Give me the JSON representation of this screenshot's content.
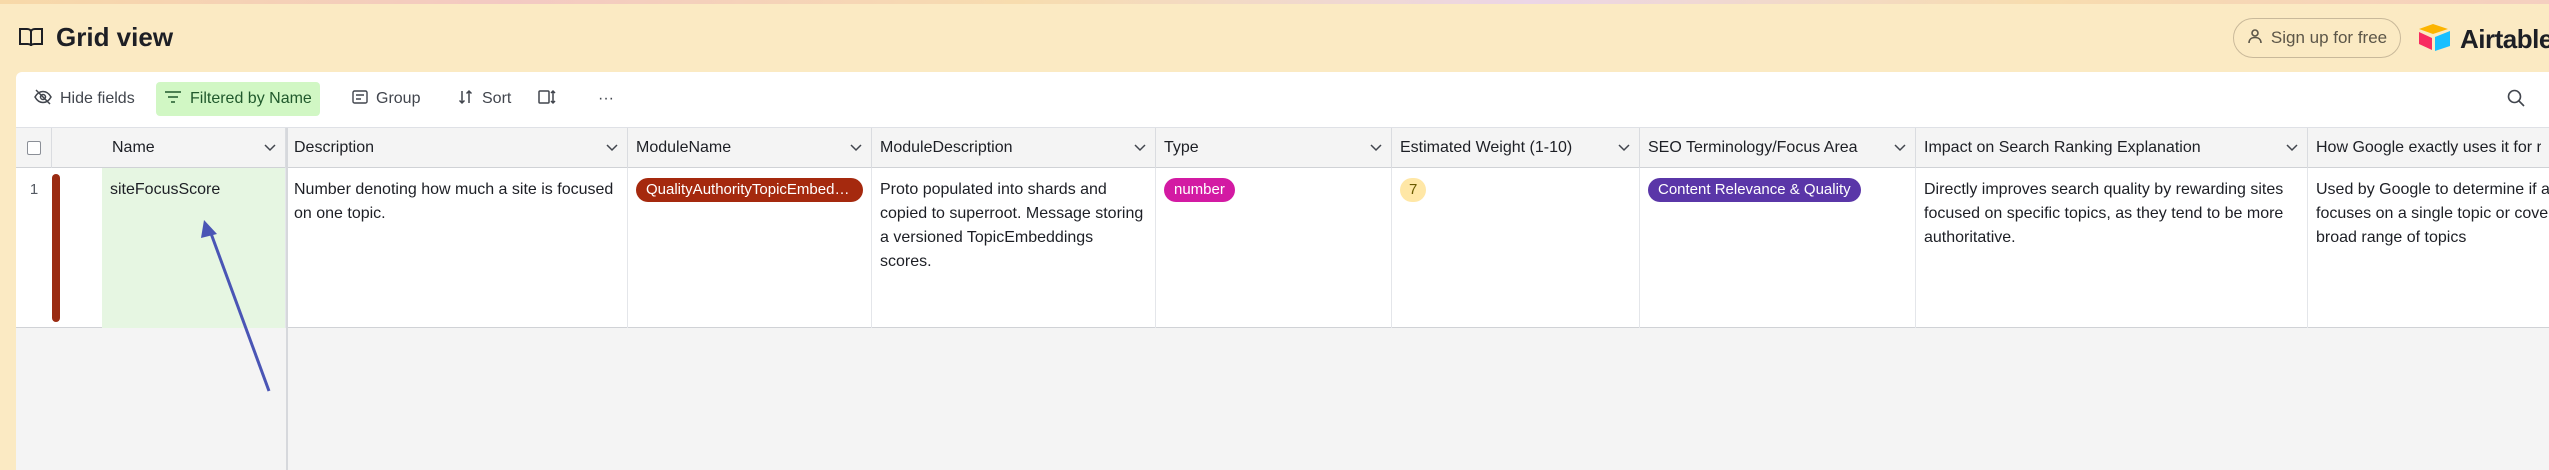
{
  "app": {
    "view_title": "Grid view",
    "signup_label": "Sign up for free",
    "brand_name": "Airtable",
    "colors": {
      "header_bg": "#fbeac3",
      "filter_active_bg": "#d1f7c4",
      "row_color_bar": "#9a2b12",
      "name_cell_bg": "#e6f6e2",
      "arrow": "#4a55b5"
    }
  },
  "toolbar": {
    "hide_fields": "Hide fields",
    "filtered_by": "Filtered by Name",
    "group": "Group",
    "sort": "Sort",
    "more": "···"
  },
  "grid": {
    "columns": [
      "Name",
      "Description",
      "ModuleName",
      "ModuleDescription",
      "Type",
      "Estimated Weight (1-10)",
      "SEO Terminology/Focus Area",
      "Impact on Search Ranking Explanation",
      "How Google exactly uses it for r"
    ],
    "rows": [
      {
        "number": "1",
        "name": "siteFocusScore",
        "description": "Number denoting how much a site is focused on one topic.",
        "module_name": "QualityAuthorityTopicEmbeddings",
        "module_description": "Proto populated into shards and copied to superroot. Message storing a versioned TopicEmbeddings scores.",
        "type": "number",
        "estimated_weight": "7",
        "seo_focus_area": "Content Relevance & Quality",
        "impact_explanation": "Directly improves search quality by rewarding sites focused on specific topics, as they tend to be more authoritative.",
        "how_google_uses": "Used by Google to determine if a site focuses on a single topic or covers a broad range of topics"
      }
    ]
  },
  "icons": {
    "view": "book-icon",
    "signup": "user-icon",
    "brand": "airtable-logo-icon",
    "hide_fields": "eye-off-icon",
    "filter": "filter-icon",
    "group": "group-icon",
    "sort": "sort-icon",
    "row_height": "row-height-icon",
    "search": "search-icon",
    "column_menu": "chevron-down-icon"
  }
}
